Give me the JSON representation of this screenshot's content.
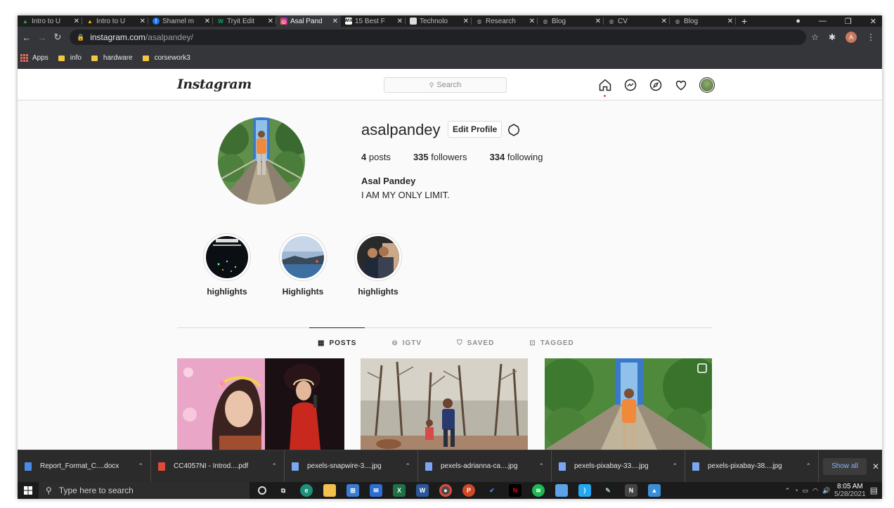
{
  "browser": {
    "tabs": [
      {
        "title": "Intro to U",
        "icon": "google-drive-icon",
        "color": "#34a853"
      },
      {
        "title": "Intro to U",
        "icon": "google-drive-icon",
        "color": "#fbbc04"
      },
      {
        "title": "Shamel m",
        "icon": "facebook-icon",
        "color": "#1877f2"
      },
      {
        "title": "Tryit Edit",
        "icon": "w3schools-icon",
        "color": "#04aa6d"
      },
      {
        "title": "Asal Pand",
        "icon": "instagram-icon",
        "color": "#e1306c"
      },
      {
        "title": "15 Best F",
        "icon": "wix-icon",
        "color": "#ffffff"
      },
      {
        "title": "Technolo",
        "icon": "page-icon",
        "color": "#dddddd"
      },
      {
        "title": "Research",
        "icon": "globe-icon",
        "color": "#9e9e9e"
      },
      {
        "title": "Blog",
        "icon": "globe-icon",
        "color": "#9e9e9e"
      },
      {
        "title": "CV",
        "icon": "globe-icon",
        "color": "#9e9e9e"
      },
      {
        "title": "Blog",
        "icon": "globe-icon",
        "color": "#9e9e9e"
      }
    ],
    "active_tab_index": 4,
    "url_domain": "instagram.com",
    "url_path": "/asalpandey/",
    "profile_initial": "A",
    "bookmarks": {
      "apps": "Apps",
      "items": [
        "info",
        "hardware",
        "corsework3"
      ]
    }
  },
  "instagram": {
    "logo": "Instagram",
    "search_placeholder": "Search",
    "profile": {
      "username": "asalpandey",
      "edit_button": "Edit Profile",
      "posts_count": "4",
      "posts_label": "posts",
      "followers_count": "335",
      "followers_label": "followers",
      "following_count": "334",
      "following_label": "following",
      "full_name": "Asal Pandey",
      "bio": "I AM MY ONLY LIMIT."
    },
    "highlights": [
      {
        "label": "highlights"
      },
      {
        "label": "Highlights"
      },
      {
        "label": "highlights"
      }
    ],
    "tabs": [
      {
        "label": "POSTS",
        "active": true
      },
      {
        "label": "IGTV",
        "active": false
      },
      {
        "label": "SAVED",
        "active": false
      },
      {
        "label": "TAGGED",
        "active": false
      }
    ]
  },
  "downloads": {
    "items": [
      {
        "name": "Report_Format_C....docx",
        "type": "word",
        "color": "#4a8be8"
      },
      {
        "name": "CC4057NI - Introd....pdf",
        "type": "pdf",
        "color": "#e04a3a"
      },
      {
        "name": "pexels-snapwire-3....jpg",
        "type": "image",
        "color": "#7aa7f0"
      },
      {
        "name": "pexels-adrianna-ca....jpg",
        "type": "image",
        "color": "#7aa7f0"
      },
      {
        "name": "pexels-pixabay-33....jpg",
        "type": "image",
        "color": "#7aa7f0"
      },
      {
        "name": "pexels-pixabay-38....jpg",
        "type": "image",
        "color": "#7aa7f0"
      }
    ],
    "show_all": "Show all"
  },
  "taskbar": {
    "search_placeholder": "Type here to search",
    "time": "8:05 AM",
    "date": "5/28/2021"
  }
}
